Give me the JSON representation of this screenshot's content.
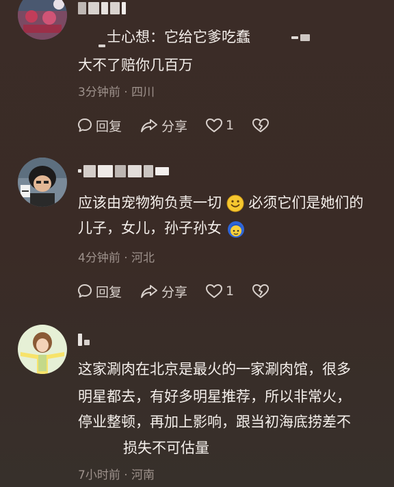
{
  "comments": [
    {
      "quote_prefix": "士心想：它给它爹吃蠢",
      "text_line": "大不了赔你几百万",
      "meta": "3分钟前 · 四川",
      "reply": "回复",
      "share": "分享",
      "likes": "1"
    },
    {
      "line1": "应该由宠物狗负责一切",
      "line1b": "必须它们是她们的",
      "line2": "儿子，女儿，孙子孙女",
      "meta": "4分钟前 · 河北",
      "reply": "回复",
      "share": "分享",
      "likes": "1"
    },
    {
      "line1": "这家涮肉在北京是最火的一家涮肉馆，很多",
      "line2": "明星都去，有好多明星推荐，所以非常火，",
      "line3": "停业整顿，再加上影响，跟当初海底捞差不",
      "line4": "损失不可估量",
      "meta": "7小时前 · 河南"
    }
  ],
  "icons": {
    "reply": "reply-bubble-icon",
    "share": "share-arrow-icon",
    "like": "heart-icon",
    "dislike": "broken-heart-icon"
  },
  "colors": {
    "background": "#3a2b26",
    "text": "#f4efeb",
    "meta": "#9e928c"
  }
}
